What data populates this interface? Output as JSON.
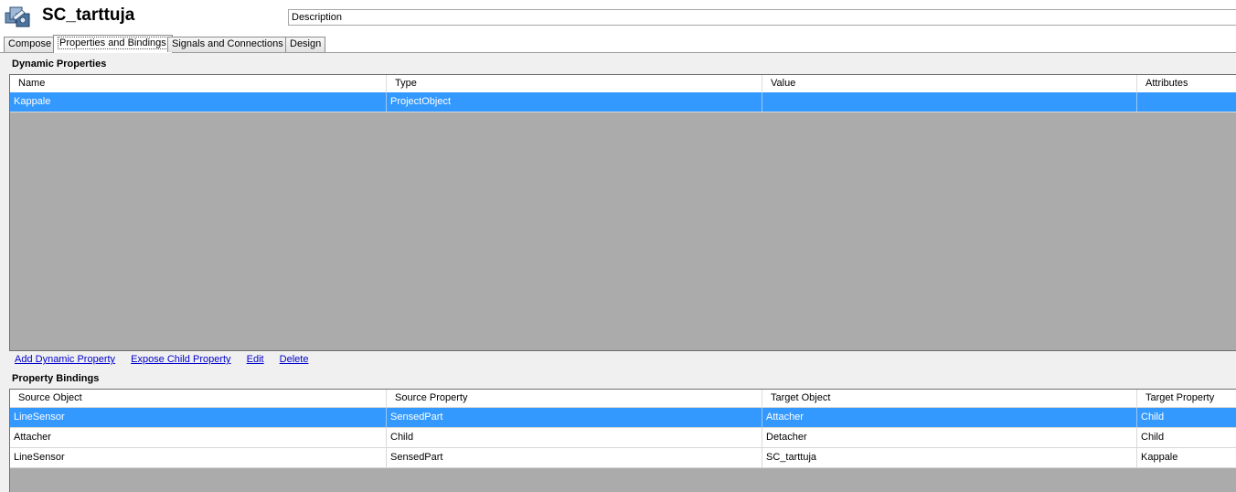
{
  "header": {
    "title": "SC_tarttuja",
    "description_placeholder": "Description"
  },
  "tabs": [
    {
      "label": "Compose",
      "active": false
    },
    {
      "label": "Properties and Bindings",
      "active": true
    },
    {
      "label": "Signals and Connections",
      "active": false
    },
    {
      "label": "Design",
      "active": false
    }
  ],
  "dynamic_properties": {
    "title": "Dynamic Properties",
    "columns": [
      "Name",
      "Type",
      "Value",
      "Attributes"
    ],
    "rows": [
      {
        "name": "Kappale",
        "type": "ProjectObject",
        "value": "",
        "attributes": "",
        "selected": true
      }
    ],
    "actions": [
      "Add Dynamic Property",
      "Expose Child Property",
      "Edit",
      "Delete"
    ]
  },
  "property_bindings": {
    "title": "Property Bindings",
    "columns": [
      "Source Object",
      "Source Property",
      "Target Object",
      "Target Property"
    ],
    "rows": [
      {
        "source_object": "LineSensor",
        "source_property": "SensedPart",
        "target_object": "Attacher",
        "target_property": "Child",
        "selected": true
      },
      {
        "source_object": "Attacher",
        "source_property": "Child",
        "target_object": "Detacher",
        "target_property": "Child",
        "selected": false
      },
      {
        "source_object": "LineSensor",
        "source_property": "SensedPart",
        "target_object": "SC_tarttuja",
        "target_property": "Kappale",
        "selected": false
      }
    ]
  },
  "colors": {
    "selection": "#3399ff",
    "grid_empty": "#ababab",
    "link": "#0000cc"
  }
}
